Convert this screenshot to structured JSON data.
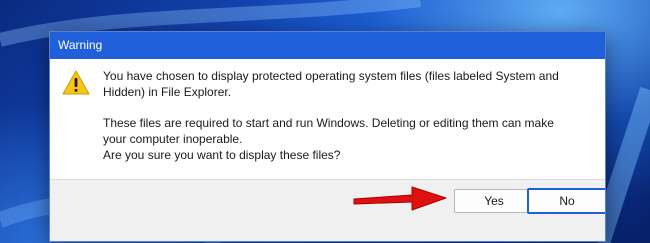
{
  "dialog": {
    "title": "Warning",
    "message_line1": "You have chosen to display protected operating system files (files labeled System and Hidden) in File Explorer.",
    "message_line2": "These files are required to start and run Windows. Deleting or editing them can make your computer inoperable.",
    "message_line3": "Are you sure you want to display these files?",
    "icon": "warning-icon",
    "buttons": {
      "yes_label": "Yes",
      "no_label": "No"
    }
  },
  "colors": {
    "title_bar": "#1f5fd9",
    "warning_yellow": "#f5c518",
    "annotation_arrow": "#e01010"
  },
  "annotation": {
    "icon": "red-arrow-pointing-to-yes"
  }
}
